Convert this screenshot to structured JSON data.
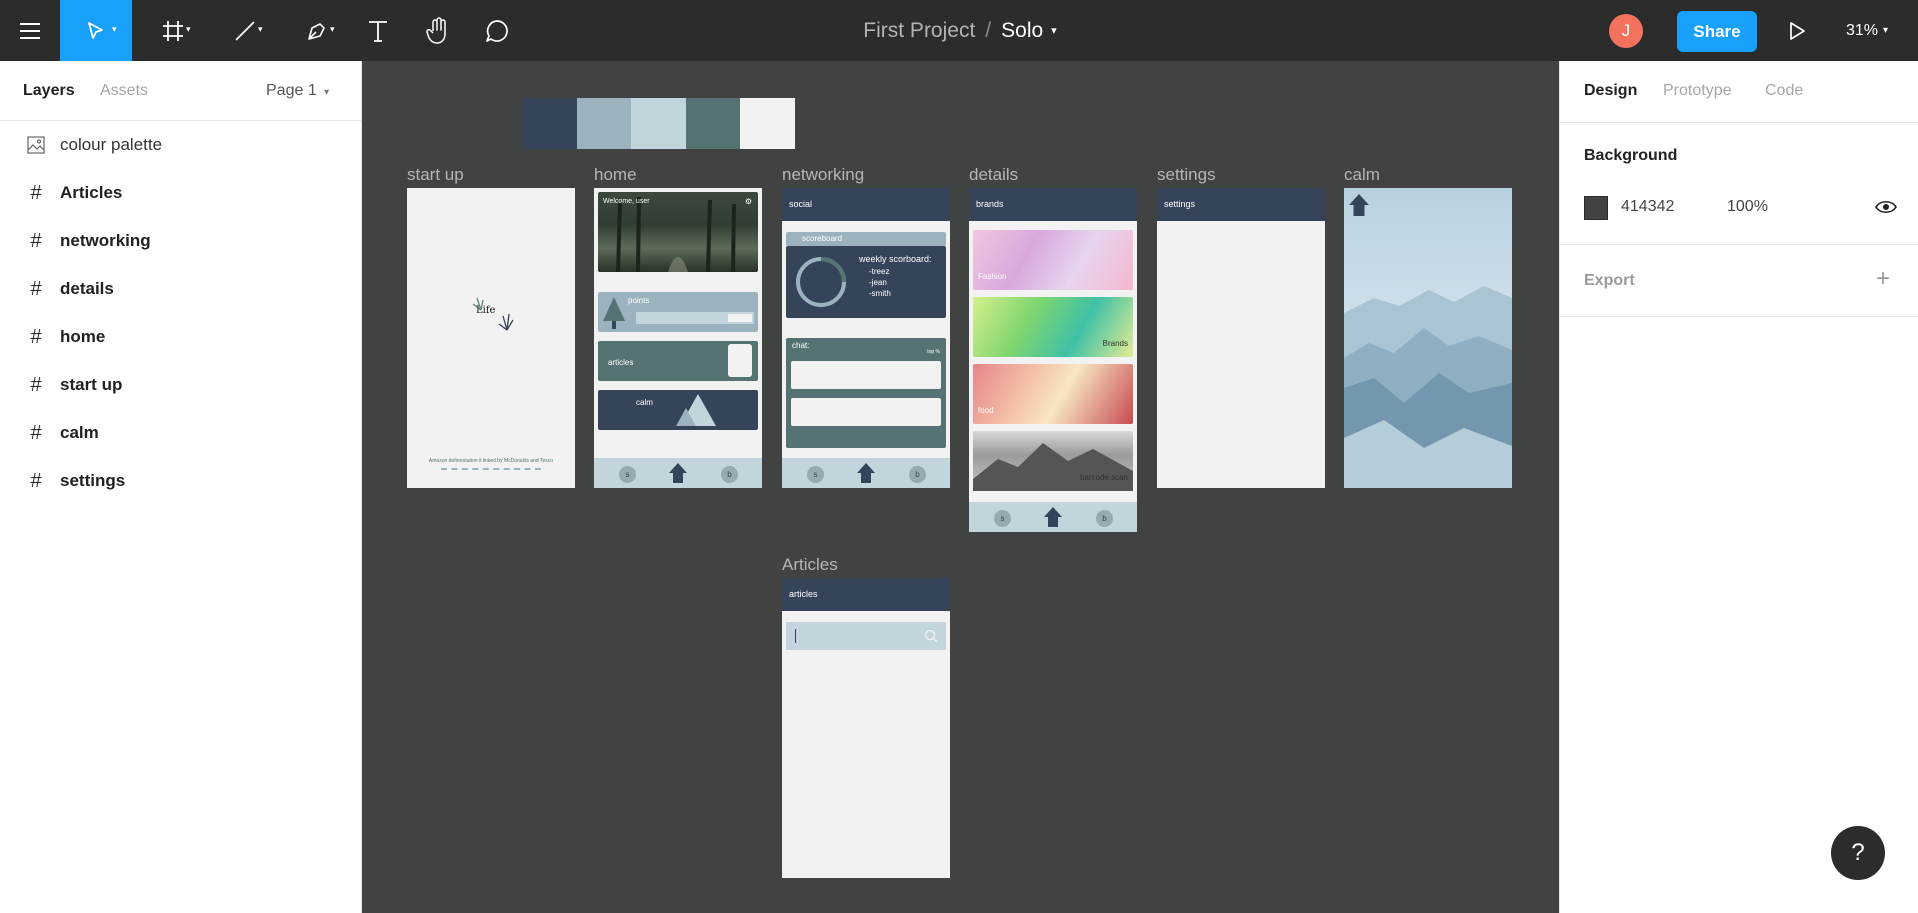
{
  "toolbar": {
    "project": "First Project",
    "separator": "/",
    "file": "Solo",
    "avatar_initial": "J",
    "share_label": "Share",
    "zoom": "31%",
    "icons": [
      "menu-icon",
      "move-tool-icon",
      "frame-tool-icon",
      "line-tool-icon",
      "pen-tool-icon",
      "text-tool-icon",
      "hand-tool-icon",
      "comment-icon",
      "present-icon"
    ]
  },
  "left_panel": {
    "tabs": [
      "Layers",
      "Assets"
    ],
    "page": "Page 1",
    "layers": [
      {
        "name": "colour palette",
        "icon": "image-icon"
      },
      {
        "name": "Articles",
        "icon": "frame-icon"
      },
      {
        "name": "networking",
        "icon": "frame-icon"
      },
      {
        "name": "details",
        "icon": "frame-icon"
      },
      {
        "name": "home",
        "icon": "frame-icon"
      },
      {
        "name": "start up",
        "icon": "frame-icon"
      },
      {
        "name": "calm",
        "icon": "frame-icon"
      },
      {
        "name": "settings",
        "icon": "frame-icon"
      }
    ]
  },
  "right_panel": {
    "tabs": [
      "Design",
      "Prototype",
      "Code"
    ],
    "background_label": "Background",
    "background_hex": "414342",
    "background_opacity": "100%",
    "export_label": "Export"
  },
  "canvas": {
    "palette": [
      "#354459",
      "#9cb3bf",
      "#c2d4dc",
      "#557372",
      "#f2f2f2"
    ],
    "frames": {
      "startup": {
        "label": "start up",
        "logo": "Life",
        "footer": "Amazon deforestation it linked by McDonalds and Tesco"
      },
      "home": {
        "label": "home",
        "welcome": "Welcome, user",
        "points": "points",
        "articles": "articles",
        "calm": "calm"
      },
      "networking": {
        "label": "networking",
        "header": "social",
        "scoreboard": "scoreboard",
        "weekly": "weekly scorboard:",
        "names": [
          "-treez",
          "-jean",
          "-smith"
        ],
        "chat": "chat:",
        "top": "top %"
      },
      "details": {
        "label": "details",
        "header": "brands",
        "fashion": "Fashion",
        "brands": "Brands",
        "food": "food",
        "barcode": "barcode scan"
      },
      "settings": {
        "label": "settings",
        "header": "settings"
      },
      "calm": {
        "label": "calm"
      },
      "articles": {
        "label": "Articles",
        "header": "articles"
      }
    },
    "nav_s": "s",
    "nav_b": "b"
  },
  "help_label": "?"
}
